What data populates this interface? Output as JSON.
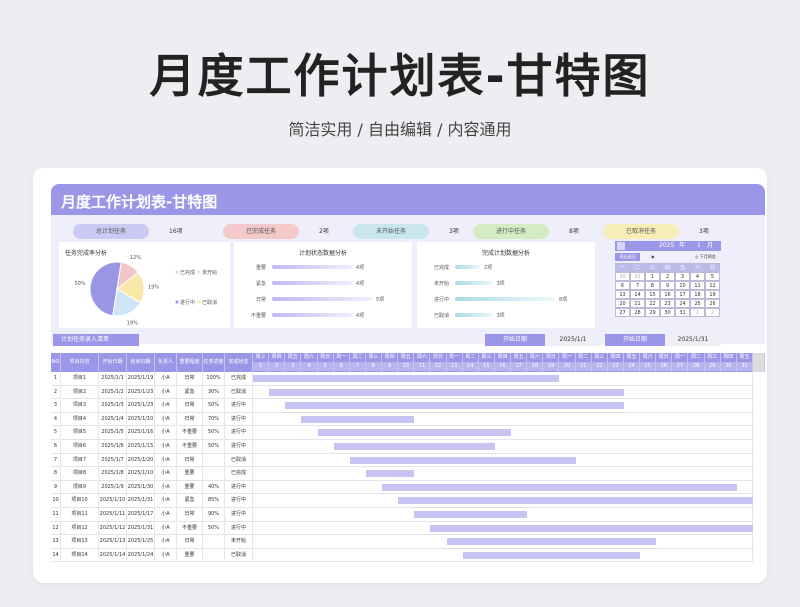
{
  "page": {
    "title": "月度工作计划表-甘特图",
    "subtitle": "简洁实用 / 自由编辑 / 内容通用"
  },
  "sheet": {
    "banner_title": "月度工作计划表-甘特图",
    "stats": [
      {
        "label": "总计划任务",
        "value": "16项",
        "color": "#cccaf2"
      },
      {
        "label": "已完成任务",
        "value": "2项",
        "color": "#f3c9c9"
      },
      {
        "label": "未开始任务",
        "value": "3项",
        "color": "#c9e6ef"
      },
      {
        "label": "进行中任务",
        "value": "8项",
        "color": "#d4ecc4"
      },
      {
        "label": "已取消任务",
        "value": "3项",
        "color": "#f7eeb8"
      }
    ],
    "pie": {
      "title": "任务完成率分析",
      "slices": [
        {
          "label": "进行中",
          "value": 50,
          "color": "#9a96e6",
          "pct": "50%"
        },
        {
          "label": "已完成",
          "value": 12,
          "color": "#f3c6c8",
          "pct": "12%"
        },
        {
          "label": "已取消",
          "value": 19,
          "color": "#fbe7a8",
          "pct": "19%"
        },
        {
          "label": "未开始",
          "value": 19,
          "color": "#cfe5f3",
          "pct": "19%"
        }
      ],
      "legend": [
        "已完成",
        "未开始",
        "进行中",
        "已取消"
      ]
    },
    "status_chart": {
      "title": "计划状态数据分析",
      "items": [
        {
          "label": "重要",
          "value": 4,
          "text": "4项"
        },
        {
          "label": "紧急",
          "value": 4,
          "text": "4项"
        },
        {
          "label": "日常",
          "value": 5,
          "text": "5项"
        },
        {
          "label": "不重要",
          "value": 4,
          "text": "4项"
        }
      ]
    },
    "complete_chart": {
      "title": "完成计划数据分析",
      "items": [
        {
          "label": "已完成",
          "value": 2,
          "text": "2项"
        },
        {
          "label": "未开始",
          "value": 3,
          "text": "3项"
        },
        {
          "label": "进行中",
          "value": 8,
          "text": "8项"
        },
        {
          "label": "已取消",
          "value": 3,
          "text": "3项"
        }
      ]
    },
    "calendar": {
      "year": "2025",
      "year_unit": "年",
      "month": "1",
      "month_unit": "月",
      "btn1": "现在返回",
      "btn2": "下月预览",
      "weekdays": [
        "一",
        "二",
        "三",
        "四",
        "五",
        "六",
        "日"
      ],
      "days": [
        "30",
        "31",
        "1",
        "2",
        "3",
        "4",
        "5",
        "6",
        "7",
        "8",
        "9",
        "10",
        "11",
        "12",
        "13",
        "14",
        "15",
        "16",
        "17",
        "18",
        "19",
        "20",
        "21",
        "22",
        "23",
        "24",
        "25",
        "26",
        "27",
        "28",
        "29",
        "30",
        "31",
        "1",
        "2"
      ]
    },
    "entry_label": "计划任务录入清单",
    "start_label": "开始日期",
    "start_value": "2025/1/1",
    "end_label": "开始日期",
    "end_value": "2025/1/31",
    "columns": [
      "NO",
      "项目内容",
      "开始日期",
      "结束日期",
      "负责人",
      "重要程度",
      "任务进度",
      "完成状态"
    ],
    "day_weeks": [
      "周三",
      "周四",
      "周五",
      "周六",
      "周日",
      "周一",
      "周二",
      "周三",
      "周四",
      "周五",
      "周六",
      "周日",
      "周一",
      "周二",
      "周三",
      "周四",
      "周五",
      "周六",
      "周日",
      "周一",
      "周二",
      "周三",
      "周四",
      "周五",
      "周六",
      "周日",
      "周一",
      "周二",
      "周三",
      "周四",
      "周五"
    ],
    "day_numbers": [
      "1",
      "2",
      "3",
      "4",
      "5",
      "6",
      "7",
      "8",
      "9",
      "10",
      "11",
      "12",
      "13",
      "14",
      "15",
      "16",
      "17",
      "18",
      "19",
      "20",
      "21",
      "22",
      "23",
      "24",
      "25",
      "26",
      "27",
      "28",
      "29",
      "30",
      "31"
    ],
    "tasks": [
      {
        "no": "1",
        "name": "项目1",
        "start": "2025/1/1",
        "end": "2025/1/19",
        "owner": "小A",
        "level": "日常",
        "progress": "100%",
        "status": "已完成",
        "s": 1,
        "e": 19
      },
      {
        "no": "2",
        "name": "项目2",
        "start": "2025/1/2",
        "end": "2025/1/23",
        "owner": "小A",
        "level": "紧急",
        "progress": "30%",
        "status": "已取消",
        "s": 2,
        "e": 23
      },
      {
        "no": "3",
        "name": "项目3",
        "start": "2025/1/3",
        "end": "2025/1/23",
        "owner": "小A",
        "level": "日常",
        "progress": "50%",
        "status": "进行中",
        "s": 3,
        "e": 23
      },
      {
        "no": "4",
        "name": "项目4",
        "start": "2025/1/4",
        "end": "2025/1/10",
        "owner": "小A",
        "level": "日常",
        "progress": "70%",
        "status": "进行中",
        "s": 4,
        "e": 10
      },
      {
        "no": "5",
        "name": "项目5",
        "start": "2025/1/5",
        "end": "2025/1/16",
        "owner": "小A",
        "level": "不重要",
        "progress": "50%",
        "status": "进行中",
        "s": 5,
        "e": 16
      },
      {
        "no": "6",
        "name": "项目6",
        "start": "2025/1/6",
        "end": "2025/1/15",
        "owner": "小A",
        "level": "不重要",
        "progress": "50%",
        "status": "进行中",
        "s": 6,
        "e": 15
      },
      {
        "no": "7",
        "name": "项目7",
        "start": "2025/1/7",
        "end": "2025/1/20",
        "owner": "小A",
        "level": "日常",
        "progress": "",
        "status": "已取消",
        "s": 7,
        "e": 20
      },
      {
        "no": "8",
        "name": "项目8",
        "start": "2025/1/8",
        "end": "2025/1/10",
        "owner": "小A",
        "level": "重要",
        "progress": "",
        "status": "已完成",
        "s": 8,
        "e": 10
      },
      {
        "no": "9",
        "name": "项目9",
        "start": "2025/1/9",
        "end": "2025/1/30",
        "owner": "小A",
        "level": "重要",
        "progress": "40%",
        "status": "进行中",
        "s": 9,
        "e": 30
      },
      {
        "no": "10",
        "name": "项目10",
        "start": "2025/1/10",
        "end": "2025/1/31",
        "owner": "小A",
        "level": "紧急",
        "progress": "85%",
        "status": "进行中",
        "s": 10,
        "e": 31
      },
      {
        "no": "11",
        "name": "项目11",
        "start": "2025/1/11",
        "end": "2025/1/17",
        "owner": "小A",
        "level": "日常",
        "progress": "90%",
        "status": "进行中",
        "s": 11,
        "e": 17
      },
      {
        "no": "12",
        "name": "项目12",
        "start": "2025/1/12",
        "end": "2025/1/31",
        "owner": "小A",
        "level": "不重要",
        "progress": "50%",
        "status": "进行中",
        "s": 12,
        "e": 31
      },
      {
        "no": "13",
        "name": "项目13",
        "start": "2025/1/13",
        "end": "2025/1/25",
        "owner": "小A",
        "level": "日常",
        "progress": "",
        "status": "未开始",
        "s": 13,
        "e": 25
      },
      {
        "no": "14",
        "name": "项目14",
        "start": "2025/1/14",
        "end": "2025/1/24",
        "owner": "小A",
        "level": "重要",
        "progress": "",
        "status": "已取消",
        "s": 14,
        "e": 24
      }
    ]
  }
}
